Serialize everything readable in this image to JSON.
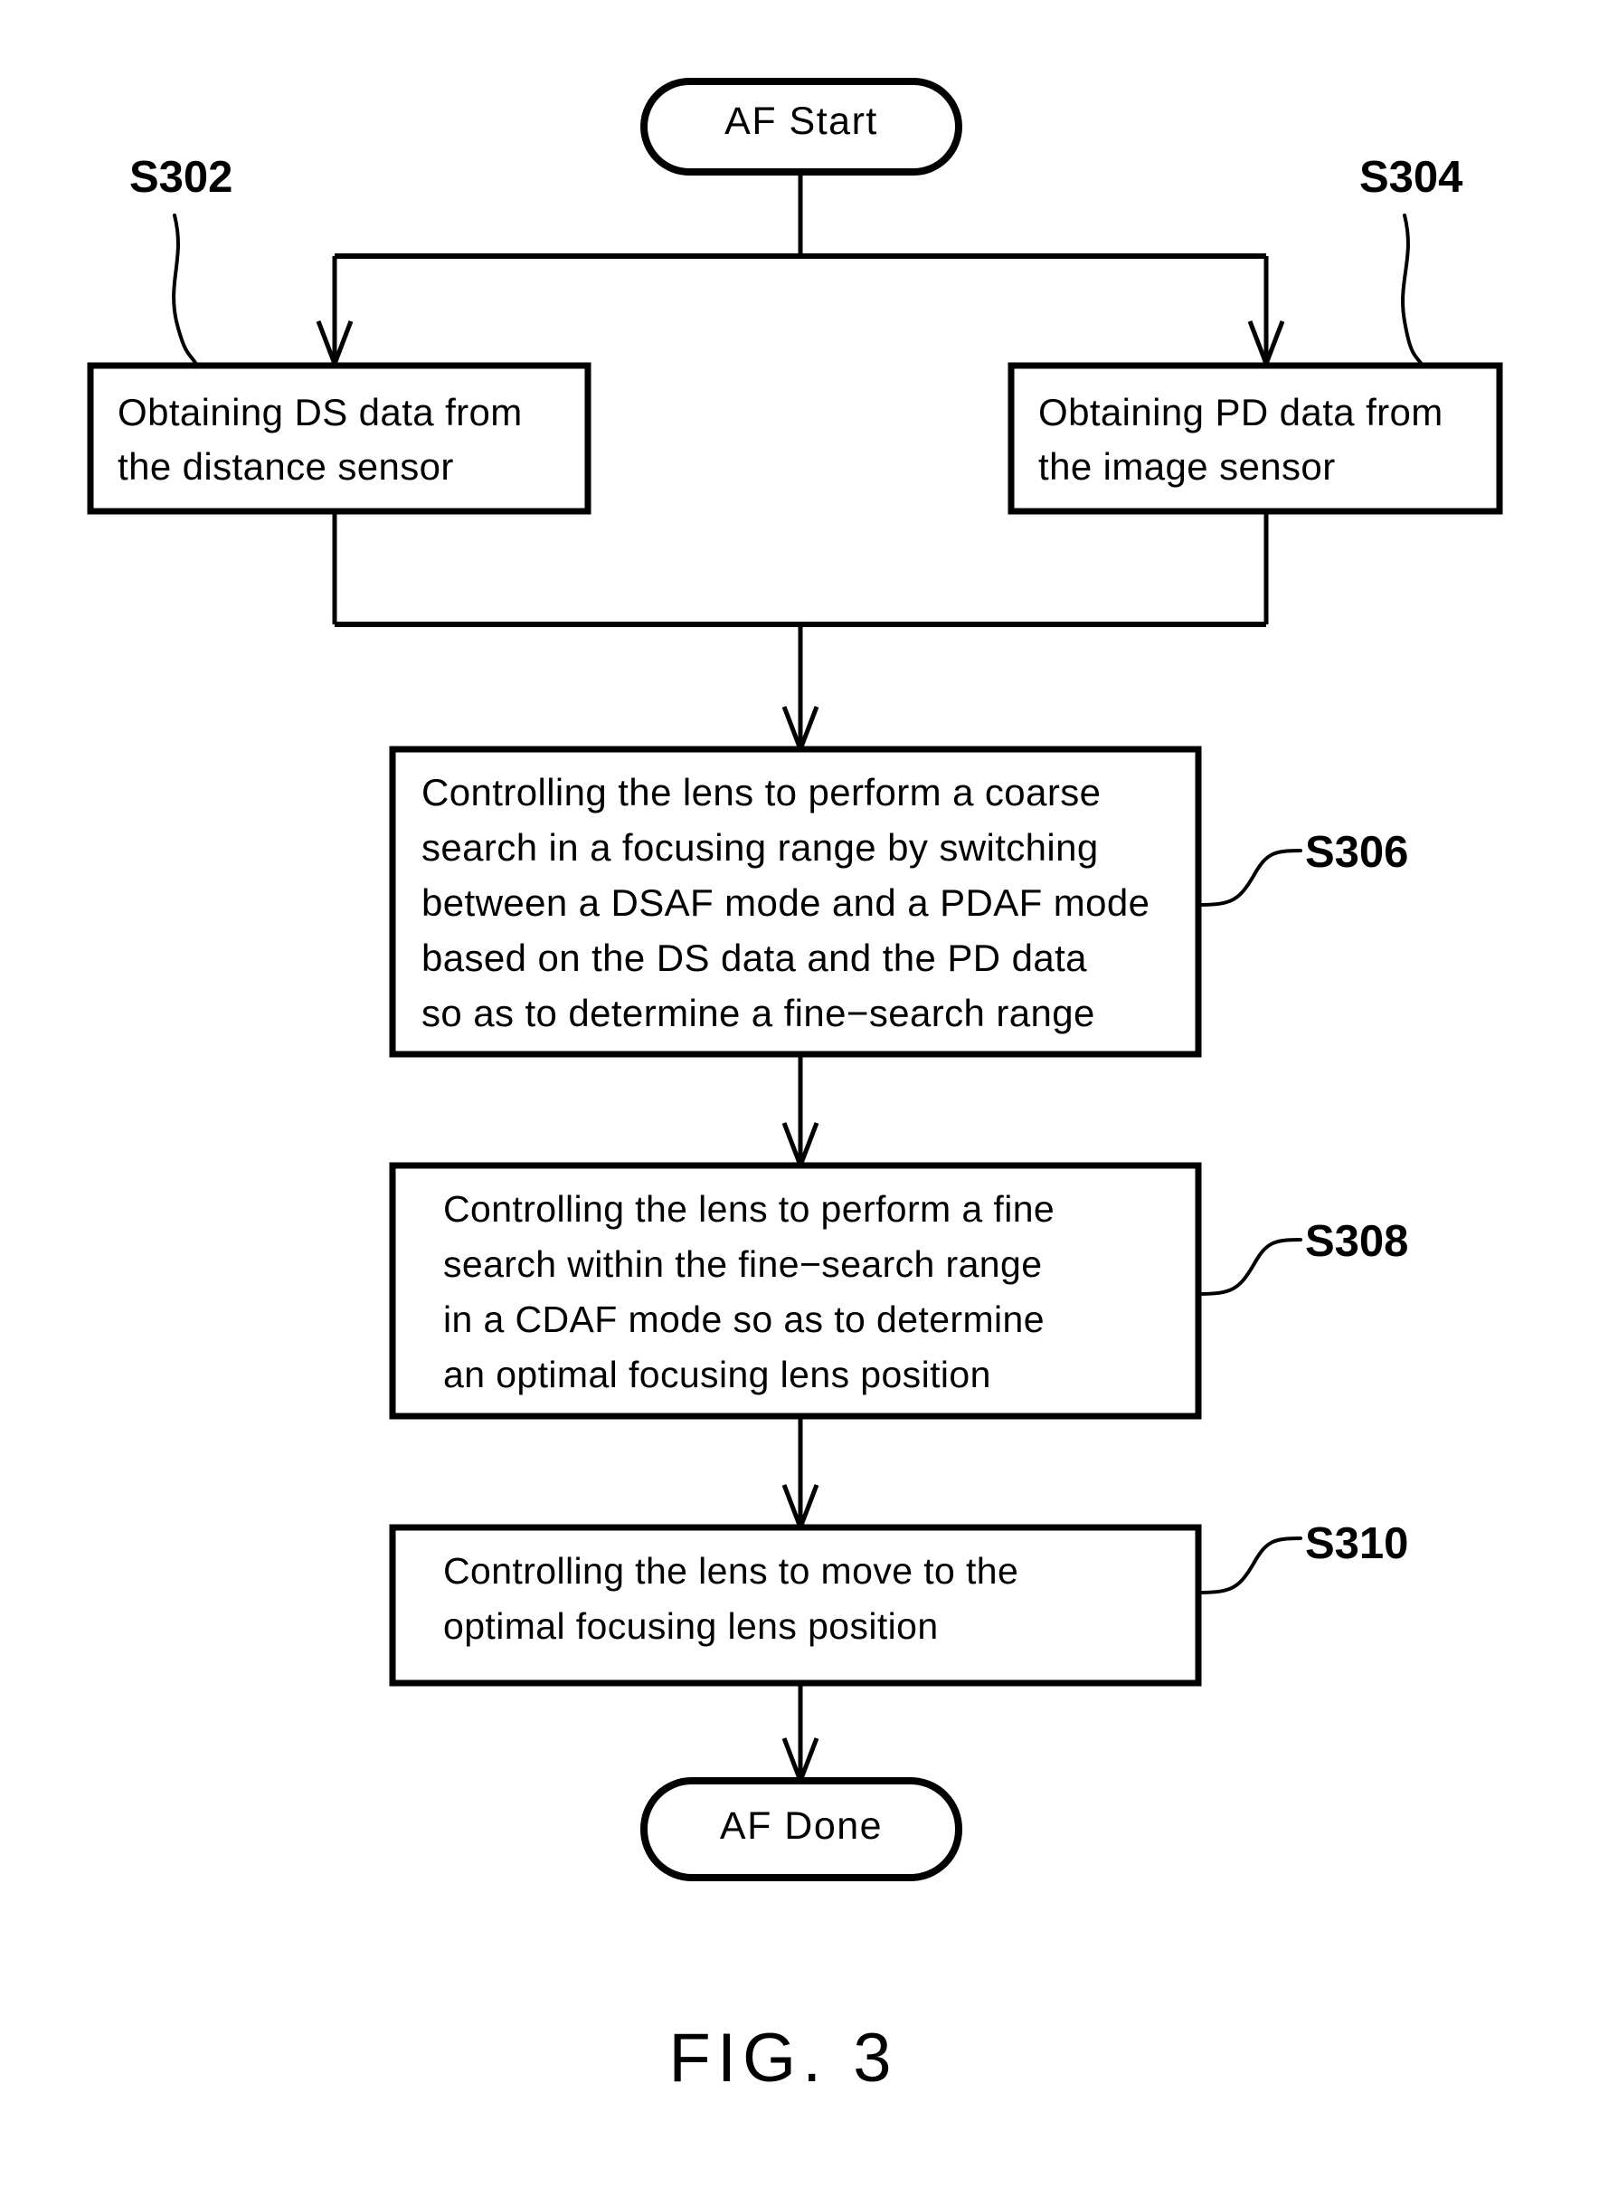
{
  "figure": {
    "caption": "FIG. 3",
    "type": "flowchart"
  },
  "nodes": {
    "start": {
      "id": "start",
      "shape": "terminal",
      "label": "AF Start"
    },
    "s302": {
      "id": "S302",
      "shape": "process",
      "step_label": "S302",
      "lines": [
        "Obtaining DS data from",
        "the distance sensor"
      ]
    },
    "s304": {
      "id": "S304",
      "shape": "process",
      "step_label": "S304",
      "lines": [
        "Obtaining PD data from",
        "the image sensor"
      ]
    },
    "s306": {
      "id": "S306",
      "shape": "process",
      "step_label": "S306",
      "lines": [
        "Controlling the lens to perform a coarse",
        "search in a focusing range by switching",
        "between a DSAF mode and a PDAF mode",
        "based on the DS data and the PD data",
        "so as to determine a fine−search range"
      ]
    },
    "s308": {
      "id": "S308",
      "shape": "process",
      "step_label": "S308",
      "lines": [
        "Controlling the lens to perform a fine",
        "search within the fine−search range",
        "in a CDAF mode so as to determine",
        "an optimal focusing lens position"
      ]
    },
    "s310": {
      "id": "S310",
      "shape": "process",
      "step_label": "S310",
      "lines": [
        "Controlling the lens to move to the",
        "optimal focusing lens position"
      ]
    },
    "done": {
      "id": "done",
      "shape": "terminal",
      "label": "AF Done"
    }
  },
  "colors": {
    "stroke": "#000000",
    "background": "#ffffff"
  }
}
